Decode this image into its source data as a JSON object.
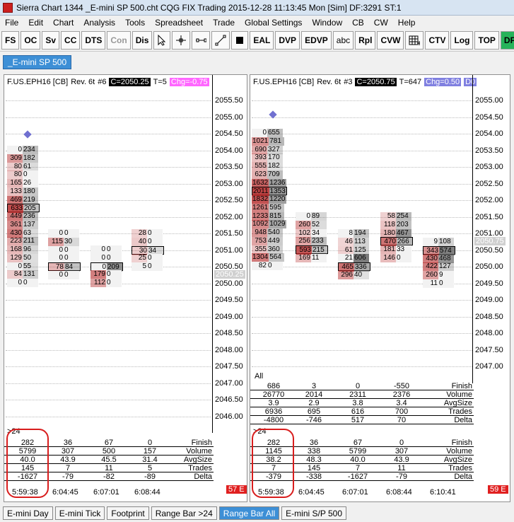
{
  "window": {
    "title": "Sierra Chart 1344 _E-mini SP 500.cht  CQG FIX Trading 2015-12-28  11:13:45 Mon [Sim]  DF:3291  ST:1"
  },
  "menu": [
    "File",
    "Edit",
    "Chart",
    "Analysis",
    "Tools",
    "Spreadsheet",
    "Trade",
    "Global Settings",
    "Window",
    "CB",
    "CW",
    "Help"
  ],
  "toolbar": [
    "FS",
    "OC",
    "Sv",
    "CC",
    "DTS",
    "Con",
    "Dis",
    "EAL",
    "DVP",
    "EDVP",
    "abc",
    "Rpl",
    "CVW",
    "CTV",
    "Log",
    "TOP",
    "DF"
  ],
  "chartbook_tab": "_E-mini SP 500",
  "colors": {
    "accent": "#3d8fd6",
    "alert": "#e02020",
    "chg_left": "#ff66ff",
    "chg_right": "#8080e0",
    "ring": "#d81d1d"
  },
  "left_chart": {
    "symbol": "F.US.EPH16 [CB]",
    "rev": "Rev. 6t",
    "num": "#6",
    "close": "C=2050.25",
    "t": "T=5",
    "chg": "Chg=-0.75",
    "prices": [
      "2055.50",
      "2055.00",
      "2054.50",
      "2054.00",
      "2053.50",
      "2053.00",
      "2052.50",
      "2052.00",
      "2051.50",
      "2051.00",
      "2050.50",
      "2050.00",
      "2049.50",
      "2049.00",
      "2048.50",
      "2048.00",
      "2047.50",
      "2047.00",
      "2046.50",
      "2046.00"
    ],
    "current": "2050.25",
    "bars": [
      [
        "0",
        "234"
      ],
      [
        "309",
        "182"
      ],
      [
        "80",
        "61"
      ],
      [
        "80",
        "0"
      ],
      [
        "165",
        "26"
      ],
      [
        "133",
        "180"
      ],
      [
        "469",
        "219"
      ],
      [
        "633",
        "205"
      ],
      [
        "449",
        "236"
      ],
      [
        "361",
        "137"
      ],
      [
        "430",
        "63"
      ],
      [
        "223",
        "211"
      ],
      [
        "168",
        "96"
      ],
      [
        "129",
        "50"
      ],
      [
        "0",
        "55"
      ],
      [
        "84",
        "131"
      ],
      [
        "0",
        "0"
      ]
    ],
    "bar2": [
      [
        "0",
        "0"
      ],
      [
        "115",
        "30"
      ],
      [
        "0",
        "0"
      ],
      [
        "0",
        "0"
      ],
      [
        "78",
        "84"
      ],
      [
        "0",
        "0"
      ]
    ],
    "bar3": [
      [
        "0",
        "0"
      ],
      [
        "0",
        "0"
      ],
      [
        "0",
        "209"
      ],
      [
        "179",
        "0"
      ],
      [
        "112",
        "0"
      ]
    ],
    "bar4": [
      [
        "28",
        "0"
      ],
      [
        "40",
        "0"
      ],
      [
        "30",
        "34"
      ],
      [
        "25",
        "0"
      ],
      [
        "5",
        "0"
      ]
    ],
    "stats_label": ">24",
    "stats": {
      "rows": [
        {
          "vals": [
            "282",
            "36",
            "67",
            "0"
          ],
          "label": "Finish"
        },
        {
          "vals": [
            "5799",
            "307",
            "500",
            "157"
          ],
          "label": "Volume"
        },
        {
          "vals": [
            "40.0",
            "43.9",
            "45.5",
            "31.4"
          ],
          "label": "AvgSize"
        },
        {
          "vals": [
            "145",
            "7",
            "11",
            "5"
          ],
          "label": "Trades"
        },
        {
          "vals": [
            "-1627",
            "-79",
            "-82",
            "-89"
          ],
          "label": "Delta"
        }
      ],
      "times": [
        "5:59:38",
        "6:04:45",
        "6:07:01",
        "6:08:44"
      ],
      "badge": "57 E"
    }
  },
  "right_chart": {
    "symbol": "F.US.EPH16 [CB]",
    "rev": "Rev. 6t",
    "num": "#3",
    "close": "C=2050.75",
    "t": "T=647",
    "chg": "Chg=0.50",
    "extra": "D0",
    "prices": [
      "2055.00",
      "2054.50",
      "2054.00",
      "2053.50",
      "2053.00",
      "2052.50",
      "2052.00",
      "2051.50",
      "2051.00",
      "2050.50",
      "2050.00",
      "2049.50",
      "2049.00",
      "2048.50",
      "2048.00",
      "2047.50",
      "2047.00"
    ],
    "current": "2050.75",
    "bar1": [
      [
        "0",
        "655"
      ],
      [
        "1021",
        "781"
      ],
      [
        "690",
        "327"
      ],
      [
        "393",
        "170"
      ],
      [
        "555",
        "182"
      ],
      [
        "623",
        "709"
      ],
      [
        "1632",
        "1236"
      ],
      [
        "2011",
        "1353"
      ],
      [
        "1832",
        "1220"
      ],
      [
        "1261",
        "595"
      ],
      [
        "1233",
        "815"
      ],
      [
        "1092",
        "1029"
      ],
      [
        "948",
        "540"
      ],
      [
        "753",
        "449"
      ],
      [
        "355",
        "360"
      ],
      [
        "1304",
        "564"
      ],
      [
        "82",
        "0"
      ]
    ],
    "bar2": [
      [
        "0",
        "89"
      ],
      [
        "260",
        "52"
      ],
      [
        "102",
        "34"
      ],
      [
        "256",
        "233"
      ],
      [
        "593",
        "215"
      ],
      [
        "169",
        "11"
      ]
    ],
    "bar3": [
      [
        "8",
        "194"
      ],
      [
        "46",
        "113"
      ],
      [
        "61",
        "125"
      ],
      [
        "21",
        "606"
      ],
      [
        "465",
        "336"
      ],
      [
        "296",
        "40"
      ]
    ],
    "bar4": [
      [
        "58",
        "254"
      ],
      [
        "118",
        "203"
      ],
      [
        "180",
        "467"
      ],
      [
        "470",
        "266"
      ],
      [
        "181",
        "33"
      ],
      [
        "146",
        "0"
      ]
    ],
    "bar5": [
      [
        "9",
        "108"
      ],
      [
        "343",
        "574"
      ],
      [
        "430",
        "468"
      ],
      [
        "422",
        "127"
      ],
      [
        "260",
        "9"
      ],
      [
        "11",
        "0"
      ]
    ],
    "all_label": "All",
    "all_stats": {
      "rows": [
        {
          "vals": [
            "686",
            "3",
            "0",
            "-550"
          ],
          "label": "Finish"
        },
        {
          "vals": [
            "26770",
            "2014",
            "2311",
            "2376"
          ],
          "label": "Volume"
        },
        {
          "vals": [
            "3.9",
            "2.9",
            "3.8",
            "3.4"
          ],
          "label": "AvgSize"
        },
        {
          "vals": [
            "6936",
            "695",
            "616",
            "700"
          ],
          "label": "Trades"
        },
        {
          "vals": [
            "-4800",
            "-746",
            "517",
            "70"
          ],
          "label": "Delta"
        }
      ]
    },
    "stats_label": ">24",
    "stats": {
      "rows": [
        {
          "vals": [
            "282",
            "36",
            "67",
            "0"
          ],
          "label": "Finish"
        },
        {
          "vals": [
            "1145",
            "338",
            "5799",
            "307"
          ],
          "label": "Volume"
        },
        {
          "vals": [
            "38.2",
            "48.3",
            "40.0",
            "43.9"
          ],
          "label": "AvgSize"
        },
        {
          "vals": [
            "7",
            "145",
            "7",
            "11"
          ],
          "label": "Trades"
        },
        {
          "vals": [
            "-379",
            "-338",
            "-1627",
            "-79"
          ],
          "label": "Delta"
        }
      ],
      "times": [
        "5:59:38",
        "6:04:45",
        "6:07:01",
        "6:08:44",
        "6:10:41"
      ],
      "badge": "59 E"
    }
  },
  "bottom_tabs": [
    "E-mini Day",
    "E-mini Tick",
    "Footprint",
    "Range Bar >24",
    "Range Bar All",
    "E-mini S/P 500"
  ],
  "active_bottom_tab": "Range Bar All"
}
